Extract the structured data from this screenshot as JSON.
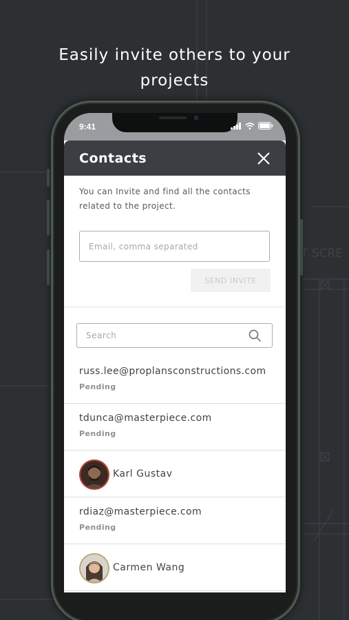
{
  "headline": {
    "line1": "Easily invite others to your",
    "line2": "projects"
  },
  "status_bar": {
    "time": "9:41",
    "icons": [
      "signal-icon",
      "wifi-icon",
      "battery-icon"
    ]
  },
  "modal": {
    "title": "Contacts",
    "close_icon": "close-icon",
    "intro_line1": "You can Invite and find all the contacts",
    "intro_line2": "related to the project.",
    "email_placeholder": "Email, comma separated",
    "send_label": "SEND INVITE",
    "search_placeholder": "Search",
    "search_icon": "search-icon"
  },
  "contacts": [
    {
      "email": "russ.lee@proplansconstructions.com",
      "status": "Pending"
    },
    {
      "email": "tdunca@masterpiece.com",
      "status": "Pending"
    },
    {
      "name": "Karl Gustav",
      "avatar": "avatar-karl"
    },
    {
      "email": "rdiaz@masterpiece.com",
      "status": "Pending"
    },
    {
      "name": "Carmen Wang",
      "avatar": "avatar-carmen"
    }
  ],
  "background_text": "T SCRE",
  "colors": {
    "background": "#2d3033",
    "header": "#3b3f44",
    "text_dark": "#3f4347",
    "text_muted": "#8d9194"
  }
}
